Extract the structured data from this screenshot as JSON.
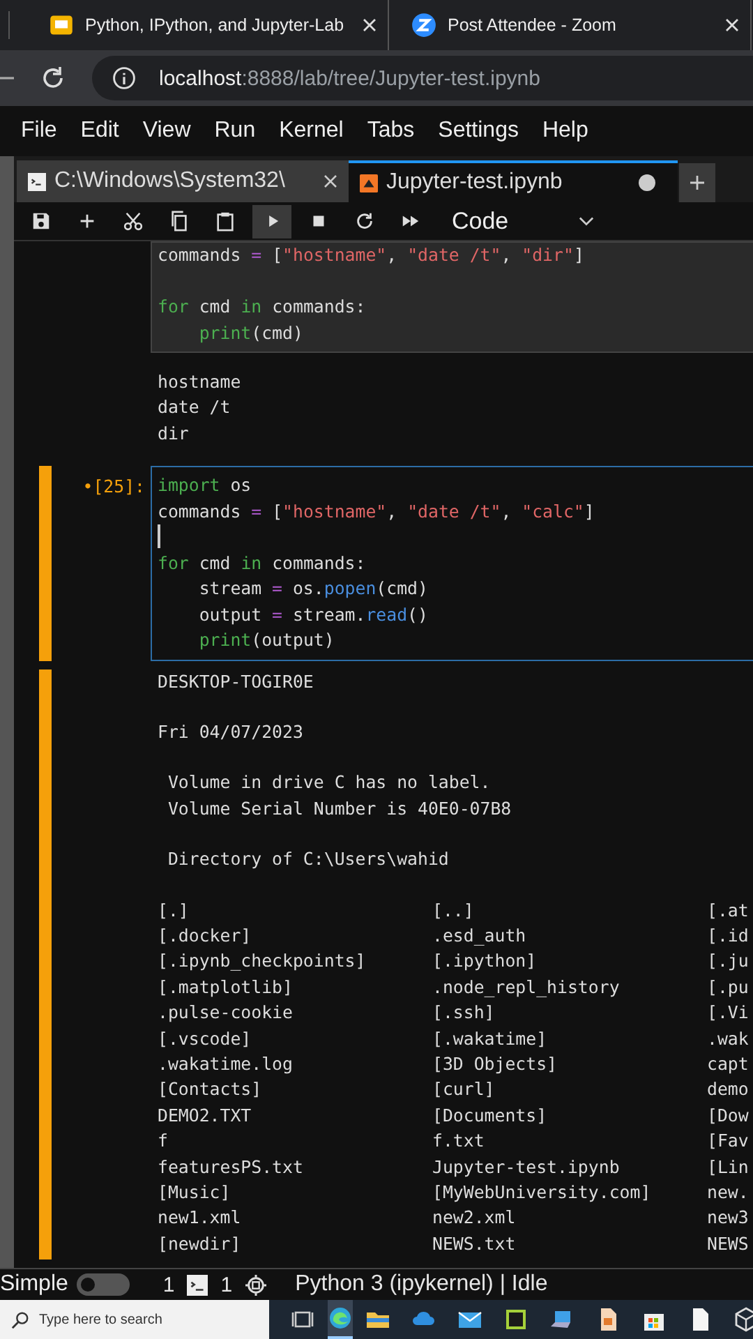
{
  "browser_tabs": [
    {
      "title": "Python, IPython, and Jupyter-Lab"
    },
    {
      "title": "Post Attendee - Zoom"
    }
  ],
  "address": {
    "host": "localhost",
    "path": ":8888/lab/tree/Jupyter-test.ipynb"
  },
  "menu": [
    "File",
    "Edit",
    "View",
    "Run",
    "Kernel",
    "Tabs",
    "Settings",
    "Help"
  ],
  "doc_tabs": [
    {
      "title": "C:\\Windows\\System32\\",
      "selected": false,
      "modified": false
    },
    {
      "title": "Jupyter-test.ipynb",
      "selected": true,
      "modified": true
    }
  ],
  "toolbar": {
    "cell_type": "Code"
  },
  "cells": [
    {
      "active": false,
      "modified": false,
      "code": [
        {
          "cursor_after": false,
          "lines": [
            {
              "indented": false,
              "tokens": [
                {
                  "t": "commands ",
                  "kind": "plain"
                },
                {
                  "t": "=",
                  "kind": "operator"
                },
                {
                  "t": " [",
                  "kind": "plain"
                },
                {
                  "t": "\"hostname\"",
                  "kind": "string"
                },
                {
                  "t": ", ",
                  "kind": "plain"
                },
                {
                  "t": "\"date /t\"",
                  "kind": "string"
                },
                {
                  "t": ", ",
                  "kind": "plain"
                },
                {
                  "t": "\"dir\"",
                  "kind": "string"
                },
                {
                  "t": "]",
                  "kind": "plain"
                }
              ]
            }
          ]
        },
        {
          "lines": [
            {
              "indented": false,
              "tokens": [
                {
                  "t": "for",
                  "kind": "keyword"
                },
                {
                  "t": " cmd ",
                  "kind": "plain"
                },
                {
                  "t": "in",
                  "kind": "keyword"
                },
                {
                  "t": " commands:",
                  "kind": "plain"
                }
              ]
            },
            {
              "indented": true,
              "tokens": [
                {
                  "t": "print",
                  "kind": "keyword"
                },
                {
                  "t": "(cmd)",
                  "kind": "plain"
                }
              ]
            }
          ]
        }
      ],
      "output": [
        [
          "hostname",
          "date /t",
          "dir"
        ]
      ]
    },
    {
      "prompt": "•[25]:",
      "active": true,
      "modified": true,
      "code": [
        {
          "cursor_after": true,
          "lines": [
            {
              "indented": false,
              "tokens": [
                {
                  "t": "import",
                  "kind": "keyword"
                },
                {
                  "t": " os",
                  "kind": "plain"
                }
              ]
            },
            {
              "indented": false,
              "tokens": [
                {
                  "t": "commands ",
                  "kind": "plain"
                },
                {
                  "t": "=",
                  "kind": "operator"
                },
                {
                  "t": " [",
                  "kind": "plain"
                },
                {
                  "t": "\"hostname\"",
                  "kind": "string"
                },
                {
                  "t": ", ",
                  "kind": "plain"
                },
                {
                  "t": "\"date /t\"",
                  "kind": "string"
                },
                {
                  "t": ", ",
                  "kind": "plain"
                },
                {
                  "t": "\"calc\"",
                  "kind": "string"
                },
                {
                  "t": "]",
                  "kind": "plain"
                }
              ]
            }
          ]
        },
        {
          "lines": [
            {
              "indented": false,
              "tokens": [
                {
                  "t": "for",
                  "kind": "keyword"
                },
                {
                  "t": " cmd ",
                  "kind": "plain"
                },
                {
                  "t": "in",
                  "kind": "keyword"
                },
                {
                  "t": " commands:",
                  "kind": "plain"
                }
              ]
            },
            {
              "indented": true,
              "tokens": [
                {
                  "t": "stream ",
                  "kind": "plain"
                },
                {
                  "t": "=",
                  "kind": "operator"
                },
                {
                  "t": " os.",
                  "kind": "plain"
                },
                {
                  "t": "popen",
                  "kind": "function"
                },
                {
                  "t": "(cmd)",
                  "kind": "plain"
                }
              ]
            },
            {
              "indented": true,
              "tokens": [
                {
                  "t": "output ",
                  "kind": "plain"
                },
                {
                  "t": "=",
                  "kind": "operator"
                },
                {
                  "t": " stream.",
                  "kind": "plain"
                },
                {
                  "t": "read",
                  "kind": "function"
                },
                {
                  "t": "()",
                  "kind": "plain"
                }
              ]
            },
            {
              "indented": true,
              "tokens": [
                {
                  "t": "print",
                  "kind": "keyword"
                },
                {
                  "t": "(output)",
                  "kind": "plain"
                }
              ]
            }
          ]
        }
      ],
      "output": [
        [
          "DESKTOP-TOGIR0E"
        ],
        [
          "Fri 04/07/2023"
        ],
        [
          " Volume in drive C has no label.",
          " Volume Serial Number is 40E0-07B8"
        ],
        [
          " Directory of C:\\Users\\wahid"
        ]
      ],
      "listing": [
        [
          "[.]",
          "[..]",
          "[.at"
        ],
        [
          "[.docker]",
          ".esd_auth",
          "[.id"
        ],
        [
          "[.ipynb_checkpoints]",
          "[.ipython]",
          "[.ju"
        ],
        [
          "[.matplotlib]",
          ".node_repl_history",
          "[.pu"
        ],
        [
          ".pulse-cookie",
          "[.ssh]",
          "[.Vi"
        ],
        [
          "[.vscode]",
          "[.wakatime]",
          ".wak"
        ],
        [
          ".wakatime.log",
          "[3D Objects]",
          "capt"
        ],
        [
          "[Contacts]",
          "[curl]",
          "demo"
        ],
        [
          "DEMO2.TXT",
          "[Documents]",
          "[Dow"
        ],
        [
          "f",
          "f.txt",
          "[Fav"
        ],
        [
          "featuresPS.txt",
          "Jupyter-test.ipynb",
          "[Lin"
        ],
        [
          "[Music]",
          "[MyWebUniversity.com]",
          "new."
        ],
        [
          "new1.xml",
          "new2.xml",
          "new3"
        ],
        [
          "[newdir]",
          "NEWS.txt",
          "NEWS"
        ]
      ]
    }
  ],
  "status": {
    "mode_label": "Simple",
    "simple_on": false,
    "terminals": "1",
    "kernels": "1",
    "kernel_status": "Python 3 (ipykernel) | Idle"
  },
  "taskbar": {
    "search_placeholder": "Type here to search"
  }
}
